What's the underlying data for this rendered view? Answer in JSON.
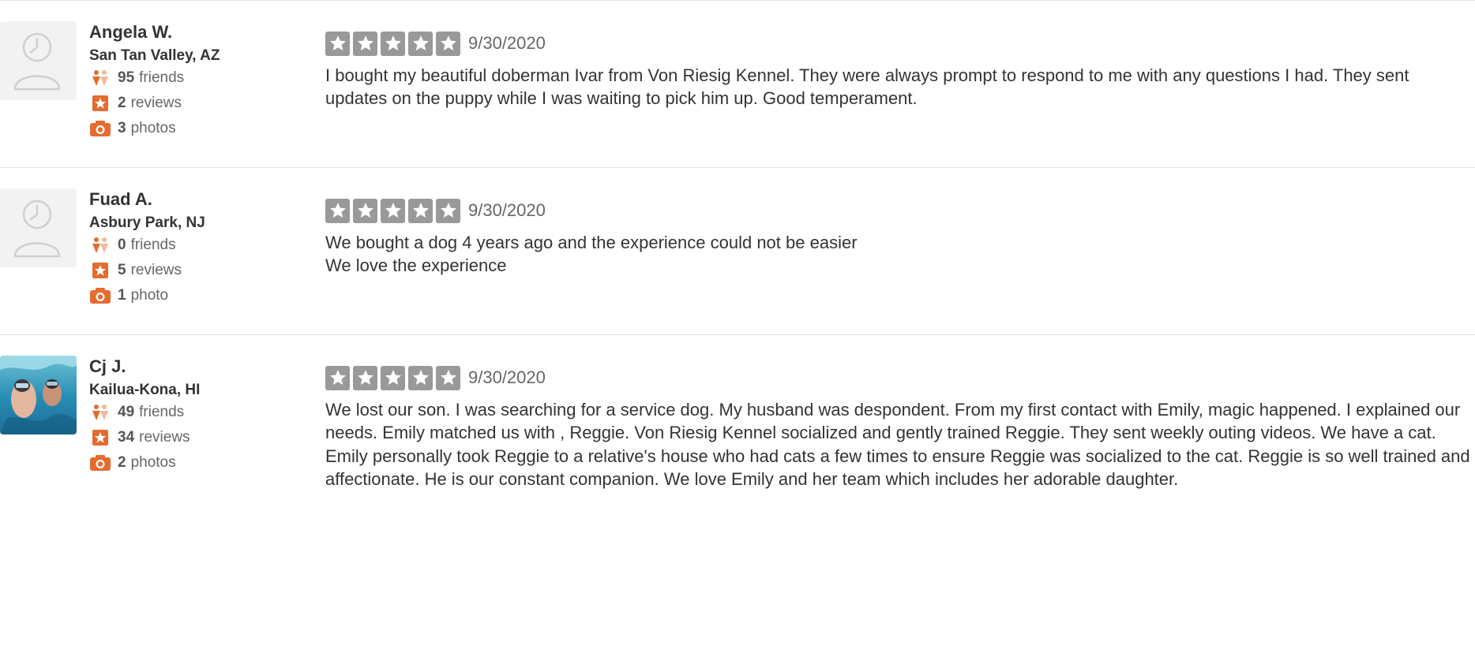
{
  "reviews": [
    {
      "user": {
        "name": "Angela W.",
        "location": "San Tan Valley, AZ",
        "friends_count": "95",
        "friends_label": "friends",
        "reviews_count": "2",
        "reviews_label": "reviews",
        "photos_count": "3",
        "photos_label": "photos",
        "avatar": "default-avatar"
      },
      "rating": 5,
      "date": "9/30/2020",
      "text": "I bought my beautiful doberman Ivar from Von Riesig Kennel. They were always prompt to respond to me with any questions I had. They sent updates on the puppy while I was waiting to pick him up. Good temperament."
    },
    {
      "user": {
        "name": "Fuad A.",
        "location": "Asbury Park, NJ",
        "friends_count": "0",
        "friends_label": "friends",
        "reviews_count": "5",
        "reviews_label": "reviews",
        "photos_count": "1",
        "photos_label": "photo",
        "avatar": "default-avatar"
      },
      "rating": 5,
      "date": "9/30/2020",
      "text": "We bought a dog 4 years ago and the experience could not be easier\nWe love the experience"
    },
    {
      "user": {
        "name": "Cj J.",
        "location": "Kailua-Kona, HI",
        "friends_count": "49",
        "friends_label": "friends",
        "reviews_count": "34",
        "reviews_label": "reviews",
        "photos_count": "2",
        "photos_label": "photos",
        "avatar": "snorkeling-photo"
      },
      "rating": 5,
      "date": "9/30/2020",
      "text": "We lost our son. I was searching for a service dog. My husband was despondent. From my first contact with Emily, magic happened. I explained  our needs. Emily matched us with , Reggie. Von Riesig Kennel socialized and gently trained  Reggie. They sent weekly outing videos. We have a cat. Emily personally took Reggie to a relative's house who had cats  a few times to ensure Reggie was socialized to the cat. Reggie is so well trained and affectionate. He is our constant companion. We love Emily and her team which includes her adorable daughter."
    }
  ],
  "colors": {
    "accent": "#e66b2e",
    "star_inactive": "#999999",
    "divider": "#e2e2e2"
  },
  "icons": {
    "friends": "friends-icon",
    "reviews": "star-badge-icon",
    "photos": "camera-icon",
    "star": "star-icon"
  }
}
